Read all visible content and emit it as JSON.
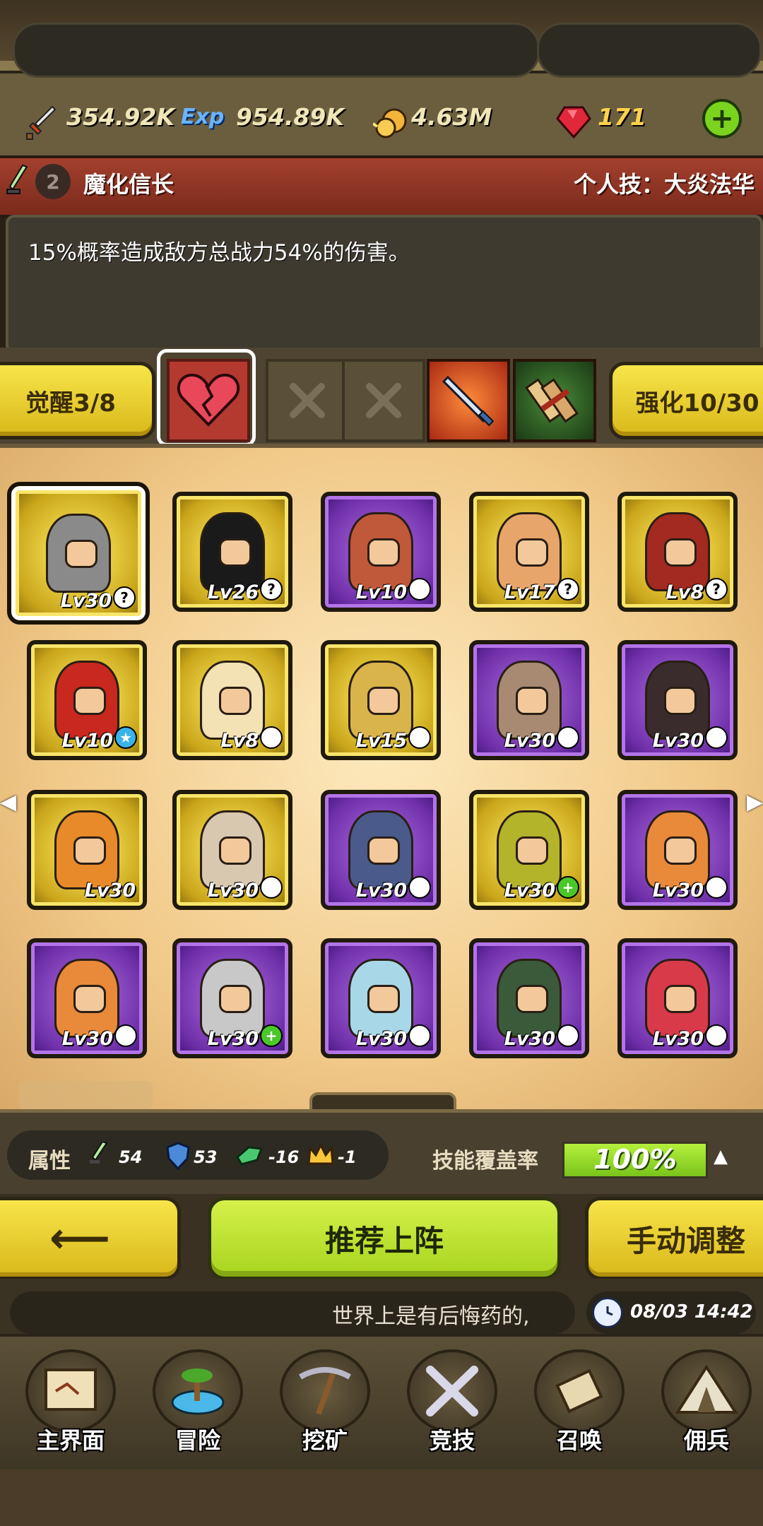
{
  "resources": {
    "attack_value": "354.92K",
    "exp_icon_text": "Exp",
    "exp_value": "954.89K",
    "gold_value": "4.63M",
    "gem_value": "171"
  },
  "hero": {
    "rank": "2",
    "name": "魔化信长",
    "skill_label": "个人技：大炎法华",
    "description": "15%概率造成敌方总战力54%的伤害。"
  },
  "skill_row": {
    "awaken_label": "觉醒3/8",
    "enhance_label": "强化10/30"
  },
  "cards": [
    {
      "level": "Lv30",
      "color": "gold",
      "badge": "?",
      "tint": "#8a8a8a"
    },
    {
      "level": "Lv26",
      "color": "gold",
      "badge": "?",
      "tint": "#1a1a1a"
    },
    {
      "level": "Lv10",
      "color": "purple",
      "badge": "↗",
      "tint": "#c0583a"
    },
    {
      "level": "Lv17",
      "color": "gold",
      "badge": "?",
      "tint": "#e8a56a"
    },
    {
      "level": "Lv8",
      "color": "gold",
      "badge": "?",
      "tint": "#a32a20"
    },
    {
      "level": "Lv10",
      "color": "gold",
      "badge": "★",
      "tint": "#c8281e"
    },
    {
      "level": "Lv8",
      "color": "gold",
      "badge": "↗",
      "tint": "#f2e2b4"
    },
    {
      "level": "Lv15",
      "color": "gold",
      "badge": "↗",
      "tint": "#d8b44a"
    },
    {
      "level": "Lv30",
      "color": "purple",
      "badge": "↗",
      "tint": "#a88a72"
    },
    {
      "level": "Lv30",
      "color": "purple",
      "badge": "↗",
      "tint": "#3a2c2c"
    },
    {
      "level": "Lv30",
      "color": "gold",
      "badge": "",
      "tint": "#e88a2a"
    },
    {
      "level": "Lv30",
      "color": "gold",
      "badge": "↗",
      "tint": "#d8c8b0"
    },
    {
      "level": "Lv30",
      "color": "purple",
      "badge": "↗",
      "tint": "#4a5a8a"
    },
    {
      "level": "Lv30",
      "color": "gold",
      "badge": "+",
      "tint": "#b4b42a"
    },
    {
      "level": "Lv30",
      "color": "purple",
      "badge": "↗",
      "tint": "#e88a3a"
    },
    {
      "level": "Lv30",
      "color": "purple",
      "badge": "↗",
      "tint": "#e88a3a"
    },
    {
      "level": "Lv30",
      "color": "purple",
      "badge": "+",
      "tint": "#c8c8c8"
    },
    {
      "level": "Lv30",
      "color": "purple",
      "badge": "↗",
      "tint": "#a8d8e8"
    },
    {
      "level": "Lv30",
      "color": "purple",
      "badge": "↗",
      "tint": "#3a5a3a"
    },
    {
      "level": "Lv30",
      "color": "purple",
      "badge": "↗",
      "tint": "#d83a4a"
    }
  ],
  "stats": {
    "label": "属性",
    "attack": "54",
    "defense": "53",
    "speed": "-16",
    "crown": "-1",
    "coverage_label": "技能覆盖率",
    "coverage_value": "100%",
    "coverage_fraction": 1.0
  },
  "actions": {
    "back_arrow": "⟵",
    "recommend_label": "推荐上阵",
    "manual_label": "手动调整"
  },
  "ticker": {
    "message": "世界上是有后悔药的,",
    "datetime": "08/03 14:42"
  },
  "nav": [
    {
      "label": "主界面",
      "icon": "map-scroll-icon"
    },
    {
      "label": "冒险",
      "icon": "island-icon"
    },
    {
      "label": "挖矿",
      "icon": "pickaxe-icon"
    },
    {
      "label": "竞技",
      "icon": "crossed-swords-icon"
    },
    {
      "label": "召唤",
      "icon": "summon-scroll-icon"
    },
    {
      "label": "佣兵",
      "icon": "tent-icon"
    }
  ],
  "colors": {
    "gold_card": "#e8cc2c",
    "purple_card": "#7a3ab8",
    "accent_green": "#a7d41e",
    "gem_red": "#d8283a"
  }
}
